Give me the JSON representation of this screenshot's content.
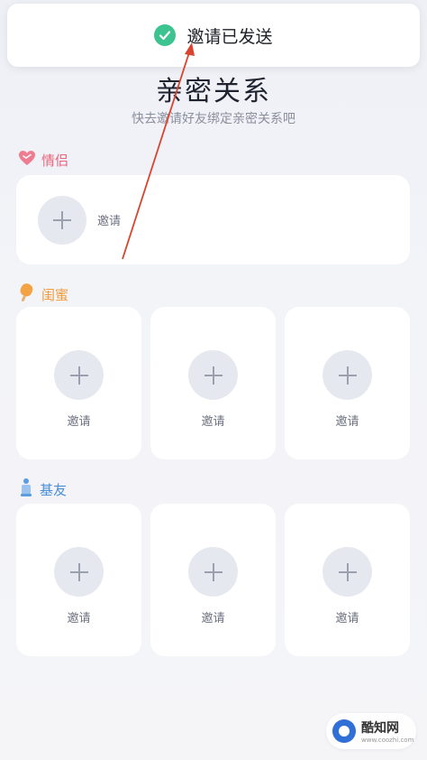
{
  "toast": {
    "text": "邀请已发送",
    "icon": "check-circle-icon",
    "color": "#3cc38f"
  },
  "header": {
    "title": "亲密关系",
    "subtitle": "快去邀请好友绑定亲密关系吧"
  },
  "sections": [
    {
      "key": "couple",
      "label": "情侣",
      "icon": "heart-icon",
      "color": "#e8667c",
      "slots": [
        {
          "invite_label": "邀请"
        }
      ]
    },
    {
      "key": "bestie",
      "label": "闺蜜",
      "icon": "popsicle-icon",
      "color": "#f09a3a",
      "slots": [
        {
          "invite_label": "邀请"
        },
        {
          "invite_label": "邀请"
        },
        {
          "invite_label": "邀请"
        }
      ]
    },
    {
      "key": "bro",
      "label": "基友",
      "icon": "bottle-icon",
      "color": "#4a90d9",
      "slots": [
        {
          "invite_label": "邀请"
        },
        {
          "invite_label": "邀请"
        },
        {
          "invite_label": "邀请"
        }
      ]
    }
  ],
  "watermark": {
    "name": "酷知网",
    "url": "www.coozhi.com"
  }
}
